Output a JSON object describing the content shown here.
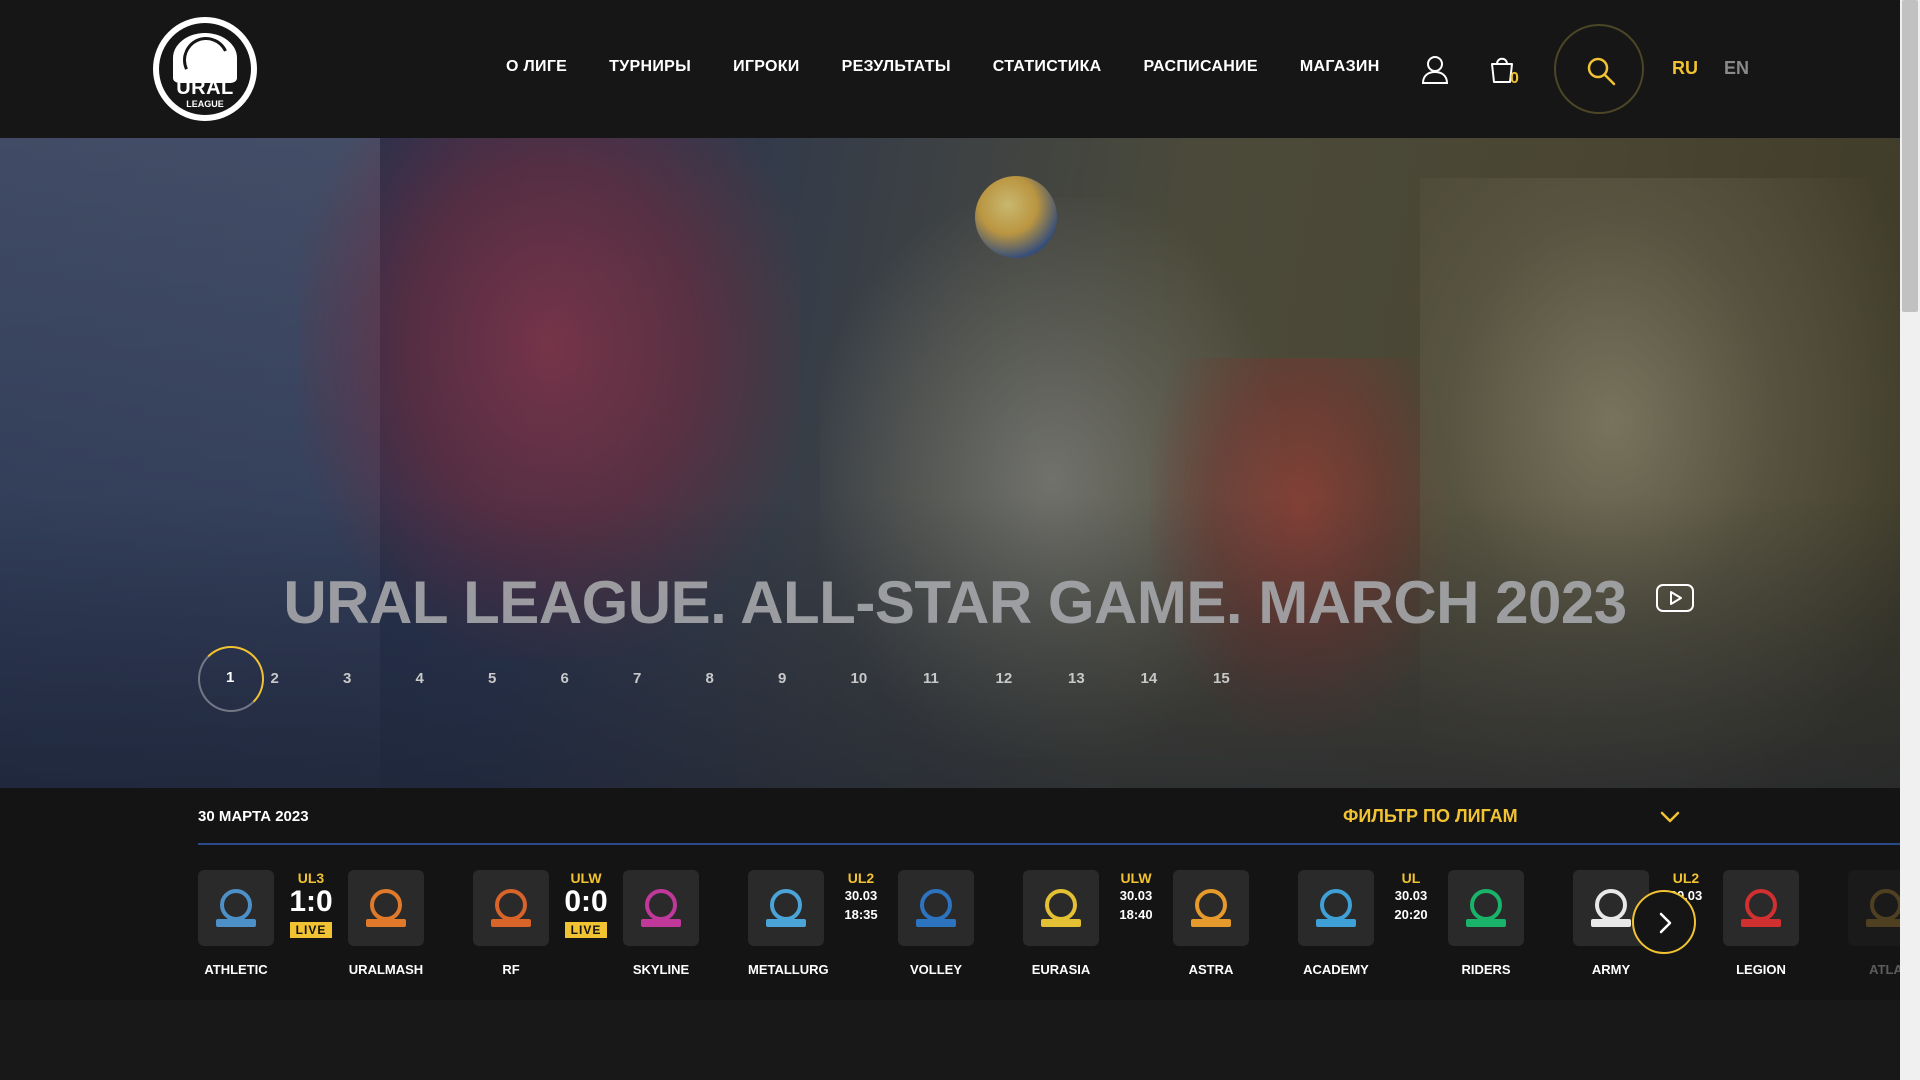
{
  "logo": {
    "title": "URAL",
    "subtitle": "LEAGUE"
  },
  "nav": [
    "О ЛИГЕ",
    "ТУРНИРЫ",
    "ИГРОКИ",
    "РЕЗУЛЬТАТЫ",
    "СТАТИСТИКА",
    "РАСПИСАНИЕ",
    "МАГАЗИН"
  ],
  "cart": {
    "count": "0"
  },
  "lang": {
    "ru": "RU",
    "en": "EN"
  },
  "hero": {
    "title": "URAL LEAGUE. ALL-STAR GAME. MARCH 2023",
    "slides": [
      "1",
      "2",
      "3",
      "4",
      "5",
      "6",
      "7",
      "8",
      "9",
      "10",
      "11",
      "12",
      "13",
      "14",
      "15"
    ],
    "active_slide": 1
  },
  "matches": {
    "date": "30 МАРТА 2023",
    "filter_label": "ФИЛЬТР ПО ЛИГАМ",
    "items": [
      {
        "home": "ATHLETIC",
        "away": "URALMASH",
        "league": "UL3",
        "score": "1:0",
        "live": "LIVE",
        "home_color": "#4d8fc7",
        "away_color": "#e07a2a"
      },
      {
        "home": "RF",
        "away": "SKYLINE",
        "league": "ULW",
        "score": "0:0",
        "live": "LIVE",
        "home_color": "#d8642a",
        "away_color": "#c0399a"
      },
      {
        "home": "METALLURG",
        "away": "VOLLEY",
        "league": "UL2",
        "date": "30.03",
        "time": "18:35",
        "home_color": "#4aa4d8",
        "away_color": "#2c74c0"
      },
      {
        "home": "EURASIA",
        "away": "ASTRA",
        "league": "ULW",
        "date": "30.03",
        "time": "18:40",
        "home_color": "#e3c034",
        "away_color": "#e79a2c"
      },
      {
        "home": "ACADEMY",
        "away": "RIDERS",
        "league": "UL",
        "date": "30.03",
        "time": "20:20",
        "home_color": "#3fa0d8",
        "away_color": "#19b46a"
      },
      {
        "home": "ARMY",
        "away": "LEGION",
        "league": "UL2",
        "date": "30.03",
        "time": "...0",
        "home_color": "#e8e8e8",
        "away_color": "#d03030"
      },
      {
        "home": "ATLA",
        "home_color": "#d6a640"
      }
    ]
  },
  "colors": {
    "accent": "#f1c232",
    "bg": "#161616",
    "divider": "#2a4a8a"
  }
}
